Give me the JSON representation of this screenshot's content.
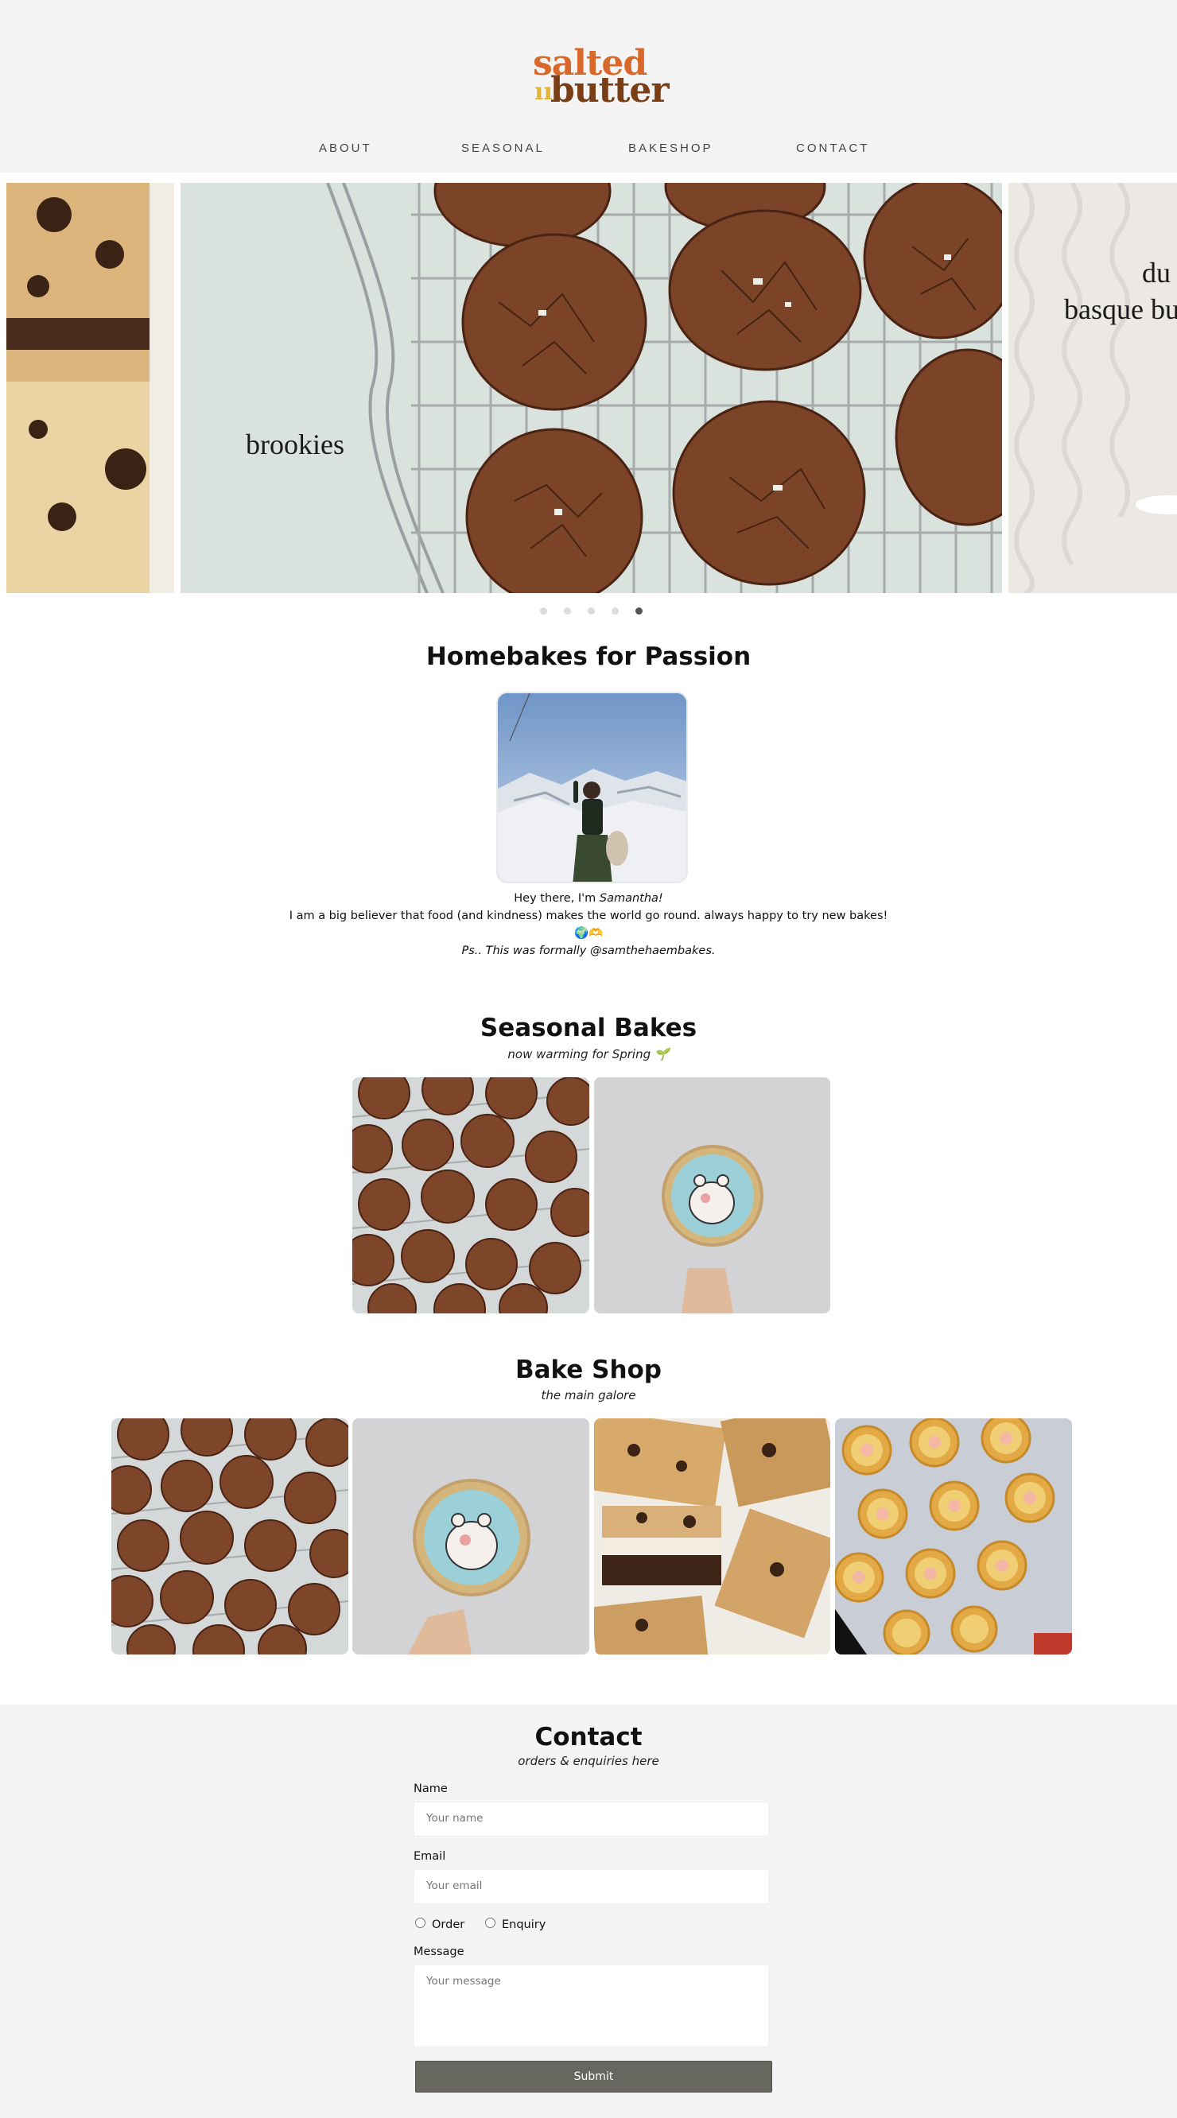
{
  "brand": {
    "logo_line1": "salted",
    "logo_line2": "butter",
    "colors": {
      "orange": "#d8692a",
      "brown": "#7a3e16",
      "yellow": "#e4b533"
    }
  },
  "nav": {
    "items": [
      {
        "label": "ABOUT"
      },
      {
        "label": "SEASONAL"
      },
      {
        "label": "BAKESHOP"
      },
      {
        "label": "CONTACT"
      }
    ]
  },
  "carousel": {
    "main_title": "brookies",
    "right_title_line1": "du",
    "right_title_line2": "basque bu",
    "dots_count": 5,
    "active_dot": 5
  },
  "about": {
    "title": "Homebakes for Passion",
    "greeting_prefix": "Hey there, I'm ",
    "name": "Samantha!",
    "line2": "I am a big believer that food (and kindness) makes the world go round. always happy to try new bakes!",
    "emoji_line": "🌍🫶",
    "ps": "Ps.. This was formally @samthehaembakes."
  },
  "seasonal": {
    "title": "Seasonal Bakes",
    "subtitle": "now warming for Spring 🌱"
  },
  "bakeshop": {
    "title": "Bake Shop",
    "subtitle": "the main galore"
  },
  "contact": {
    "title": "Contact",
    "subtitle": "orders & enquiries here",
    "name_label": "Name",
    "name_placeholder": "Your name",
    "email_label": "Email",
    "email_placeholder": "Your email",
    "radio_order": "Order",
    "radio_enquiry": "Enquiry",
    "message_label": "Message",
    "message_placeholder": "Your message",
    "submit_label": "Submit"
  }
}
